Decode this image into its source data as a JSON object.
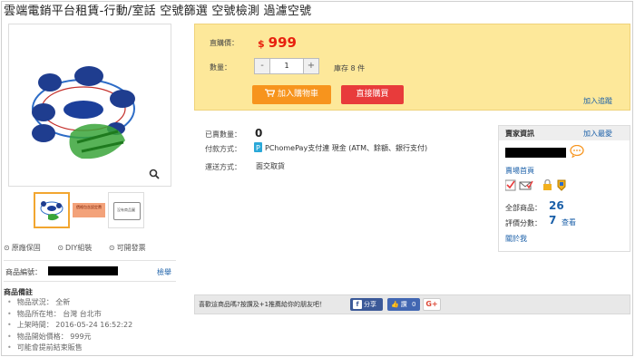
{
  "title": "雲端電銷平台租賃-行動/室話 空號篩選 空號檢測 過濾空號",
  "gallery": {
    "thumb2_text": "價格包含設定費",
    "thumb3_text": "沒有商品圖"
  },
  "features": [
    "原廠保固",
    "DIY組裝",
    "可開發票"
  ],
  "product_id": {
    "label": "商品編號：",
    "link": "檢舉"
  },
  "notes": {
    "title": "商品備註",
    "items": [
      "物品狀況： 全新",
      "物品所在地： 台灣 台北市",
      "上架時間： 2016-05-24 16:52:22",
      "物品開始價格： 999元",
      "可能會提前結束販售"
    ]
  },
  "purchase": {
    "price_label": "直購價：",
    "currency": "$",
    "price": "999",
    "qty_label": "數量：",
    "minus": "-",
    "qty": "1",
    "plus": "+",
    "stock": "庫存 8 件",
    "cart_button": "加入購物車",
    "buy_button": "直接購買",
    "track_link": "加入追蹤"
  },
  "info": {
    "sold_label": "已賣數量：",
    "sold_value": "0",
    "pay_label": "付款方式：",
    "pay_value": "PChomePay支付連 現金 (ATM、餘額、銀行支付)",
    "ship_label": "運送方式：",
    "ship_value": "面交取貨"
  },
  "seller": {
    "title": "賣家資訊",
    "follow": "加入最愛",
    "store_home": "賣場首頁",
    "total_label": "全部商品：",
    "total_value": "26",
    "rating_label": "評價分數：",
    "rating_value": "7",
    "rating_link": "查看",
    "about": "關於我"
  },
  "share": {
    "text": "喜歡這商品嗎?按讚及+1推薦給你的朋友吧！",
    "fb_share": "分享",
    "fb_like": "讚",
    "fb_like_count": "0",
    "gplus": "G+"
  },
  "colors": {
    "price_red": "#e8200e",
    "cart_orange": "#f7941d",
    "buy_red": "#e83b3b",
    "link_blue": "#1a5fa8",
    "panel_yellow": "#fde89a"
  }
}
